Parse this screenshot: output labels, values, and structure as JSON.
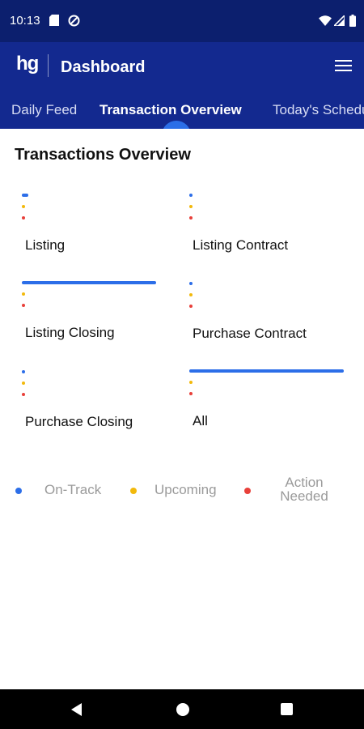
{
  "status_bar": {
    "time": "10:13",
    "icons": [
      "sd-card-icon",
      "sync-icon",
      "wifi-icon",
      "signal-icon",
      "battery-icon"
    ]
  },
  "app_bar": {
    "logo": "hg",
    "title": "Dashboard",
    "menu_icon": "hamburger-menu-icon"
  },
  "tabs": [
    {
      "label": "Daily Feed",
      "active": false
    },
    {
      "label": "Transaction Overview",
      "active": true
    },
    {
      "label": "Today's Schedule",
      "active": false
    }
  ],
  "overview": {
    "title": "Transactions Overview",
    "categories": [
      {
        "label": "Listing",
        "on_track": 0.04,
        "upcoming": 0,
        "action_needed": 0
      },
      {
        "label": "Listing Contract",
        "on_track": 0.02,
        "upcoming": 0,
        "action_needed": 0
      },
      {
        "label": "Listing Closing",
        "on_track": 0.8,
        "upcoming": 0,
        "action_needed": 0
      },
      {
        "label": "Purchase Contract",
        "on_track": 0.02,
        "upcoming": 0,
        "action_needed": 0
      },
      {
        "label": "Purchase Closing",
        "on_track": 0.02,
        "upcoming": 0,
        "action_needed": 0
      },
      {
        "label": "All",
        "on_track": 0.92,
        "upcoming": 0,
        "action_needed": 0
      }
    ]
  },
  "legend": [
    {
      "label": "On-Track",
      "color": "#2c6ee8"
    },
    {
      "label": "Upcoming",
      "color": "#f2b90c"
    },
    {
      "label": "Action Needed",
      "color": "#e8403a"
    }
  ],
  "nav_bar": {
    "icons": [
      "back-icon",
      "home-icon",
      "recent-apps-icon"
    ]
  }
}
